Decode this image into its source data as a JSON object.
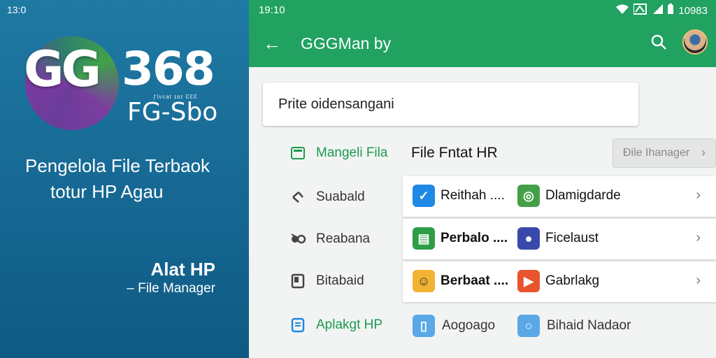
{
  "left": {
    "time": "13:0",
    "logo_main": "GG",
    "logo_number": "368",
    "logo_tiny": "ƒlvcat    ɪɒɪ ƐƐƐ",
    "logo_sub": "FG-Sbo",
    "tagline_line1": "Pengelola File Terbaok",
    "tagline_line2": "totur HP Agau",
    "alat": "Alat HP",
    "file_manager": "– File Manager"
  },
  "statusbar": {
    "time": "19:10",
    "battery": "10983"
  },
  "appbar": {
    "title": "GGGMan by",
    "back_icon": "arrow-back-icon",
    "search_icon": "search-icon"
  },
  "search": {
    "value": "Prite oidensangani"
  },
  "nav": {
    "items": [
      {
        "label": "Mangeli Fila",
        "icon": "folder-icon"
      },
      {
        "label": "Suabald",
        "icon": "share-icon"
      },
      {
        "label": "Reabana",
        "icon": "robot-icon"
      },
      {
        "label": "Bitabaid",
        "icon": "document-icon"
      },
      {
        "label": "Aplakgt HP",
        "icon": "file-icon"
      }
    ]
  },
  "heading": "File Fntat HR",
  "fm_button": "Ðile Ihanager",
  "rows": [
    {
      "left": "Reithah ....",
      "right": "Dlamigdarde",
      "left_color": "#1e88e5",
      "right_color": "#43a047"
    },
    {
      "left": "Perbalo ....",
      "right": "Ficelaust",
      "left_color": "#2e9d48",
      "right_color": "#3949ab"
    },
    {
      "left": "Berbaat ....",
      "right": "Gabrlakg",
      "left_color": "#f2b233",
      "right_color": "#e8542c"
    }
  ],
  "bottom": {
    "mid": "Aogoago",
    "right": "Bihaid Nadaor"
  }
}
